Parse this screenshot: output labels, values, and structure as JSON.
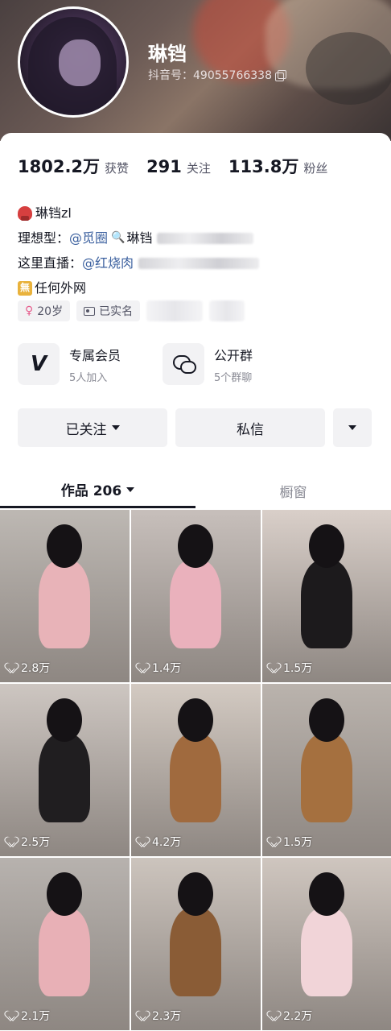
{
  "profile": {
    "name": "琳铛",
    "douyin_id": "抖音号：49055766338"
  },
  "stats": [
    {
      "num": "1802.2万",
      "label": "获赞"
    },
    {
      "num": "291",
      "label": "关注"
    },
    {
      "num": "113.8万",
      "label": "粉丝"
    }
  ],
  "bio": {
    "line1": "琳铛zl",
    "line2_prefix": "理想型：",
    "line2_link": "@觅圈",
    "line2_tail": "琳铛",
    "line3_prefix": "这里直播：",
    "line3_link": "@红烧肉",
    "line4_badge": "無",
    "line4_text": "任何外网"
  },
  "tags": [
    {
      "label": "20岁",
      "icon": "female-icon"
    },
    {
      "label": "已实名",
      "icon": "id-card-icon"
    }
  ],
  "features": [
    {
      "title": "专属会员",
      "sub": "5人加入",
      "icon": "v-icon"
    },
    {
      "title": "公开群",
      "sub": "5个群聊",
      "icon": "chat-icon"
    }
  ],
  "actions": {
    "follow": "已关注",
    "message": "私信"
  },
  "tabs": [
    {
      "label": "作品 206",
      "active": true
    },
    {
      "label": "橱窗",
      "active": false
    }
  ],
  "videos": [
    {
      "likes": "2.8万",
      "bg": "#bdb8b3",
      "outfit": "#e8b3b8"
    },
    {
      "likes": "1.4万",
      "bg": "#c7bfbb",
      "outfit": "#eab1bc"
    },
    {
      "likes": "1.5万",
      "bg": "#d9cfc9",
      "outfit": "#1c1a1c"
    },
    {
      "likes": "2.5万",
      "bg": "#cdc6c1",
      "outfit": "#201e20"
    },
    {
      "likes": "4.2万",
      "bg": "#d3cac2",
      "outfit": "#a06a3e"
    },
    {
      "likes": "1.5万",
      "bg": "#bab3ad",
      "outfit": "#a5703f"
    },
    {
      "likes": "2.1万",
      "bg": "#b7b2ae",
      "outfit": "#e8b0b6"
    },
    {
      "likes": "2.3万",
      "bg": "#ccc4bd",
      "outfit": "#8a5c36"
    },
    {
      "likes": "2.2万",
      "bg": "#cfc6bf",
      "outfit": "#f1d4d8"
    }
  ]
}
